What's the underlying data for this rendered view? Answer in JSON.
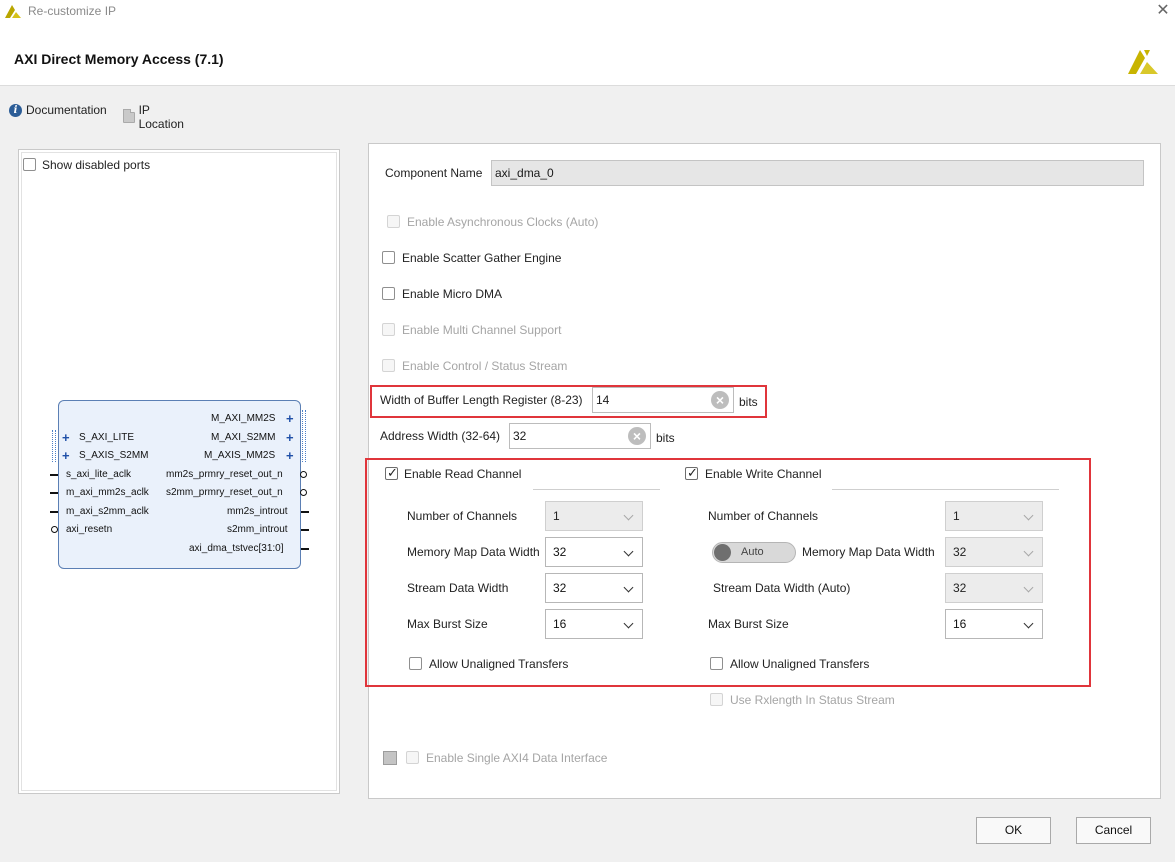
{
  "window": {
    "title": "Re-customize IP",
    "close_glyph": "✕",
    "heading": "AXI Direct Memory Access (7.1)"
  },
  "toolbar": {
    "documentation": "Documentation",
    "ip_location": "IP Location"
  },
  "left": {
    "show_disabled_ports": "Show disabled ports",
    "block": {
      "left_ports": [
        "S_AXI_LITE",
        "S_AXIS_S2MM",
        "s_axi_lite_aclk",
        "m_axi_mm2s_aclk",
        "m_axi_s2mm_aclk",
        "axi_resetn"
      ],
      "right_ports": [
        "M_AXI_MM2S",
        "M_AXI_S2MM",
        "M_AXIS_MM2S",
        "mm2s_prmry_reset_out_n",
        "s2mm_prmry_reset_out_n",
        "mm2s_introut",
        "s2mm_introut",
        "axi_dma_tstvec[31:0]"
      ]
    }
  },
  "config": {
    "component_name_label": "Component Name",
    "component_name_value": "axi_dma_0",
    "async_clocks": "Enable Asynchronous Clocks (Auto)",
    "scatter_gather": "Enable Scatter Gather Engine",
    "micro_dma": "Enable Micro DMA",
    "multi_channel": "Enable Multi Channel Support",
    "control_status": "Enable Control / Status Stream",
    "buffer_length_label": "Width of Buffer Length Register (8-23)",
    "buffer_length_value": "14",
    "buffer_length_unit": "bits",
    "address_width_label": "Address Width (32-64)",
    "address_width_value": "32",
    "address_width_unit": "bits",
    "read": {
      "enable_label": "Enable Read Channel",
      "num_channels_label": "Number of Channels",
      "num_channels_value": "1",
      "mm_data_width_label": "Memory Map Data Width",
      "mm_data_width_value": "32",
      "stream_width_label": "Stream Data Width",
      "stream_width_value": "32",
      "max_burst_label": "Max Burst Size",
      "max_burst_value": "16",
      "unaligned_label": "Allow Unaligned Transfers"
    },
    "write": {
      "enable_label": "Enable Write Channel",
      "num_channels_label": "Number of Channels",
      "num_channels_value": "1",
      "auto_toggle": "Auto",
      "mm_data_width_label": "Memory Map Data Width",
      "mm_data_width_value": "32",
      "stream_width_label": "Stream Data Width (Auto)",
      "stream_width_value": "32",
      "max_burst_label": "Max Burst Size",
      "max_burst_value": "16",
      "unaligned_label": "Allow Unaligned Transfers"
    },
    "rxlength": "Use Rxlength In Status Stream",
    "single_axi4": "Enable Single AXI4 Data Interface"
  },
  "buttons": {
    "ok": "OK",
    "cancel": "Cancel"
  },
  "colors": {
    "highlight_box": "#e0353b",
    "brand": "#c8b400"
  }
}
